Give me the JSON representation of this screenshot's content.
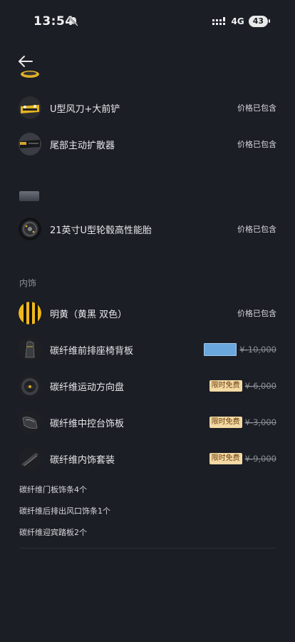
{
  "status_bar": {
    "time": "13:54",
    "network": "4G",
    "battery": "43"
  },
  "header": {
    "back_icon": "arrow-left-icon"
  },
  "exterior_items": [
    {
      "name": "U型风刀+大前铲",
      "price_text": "价格已包含"
    },
    {
      "name": "尾部主动扩散器",
      "price_text": "价格已包含"
    },
    {
      "name": "21英寸U型轮毂高性能胎",
      "price_text": "价格已包含"
    }
  ],
  "interior": {
    "section_title": "内饰",
    "items": [
      {
        "name": "明黄（黄黑 双色）",
        "price_text": "价格已包含"
      },
      {
        "name": "碳纤维前排座椅背板",
        "price": "¥-10,000"
      },
      {
        "name": "碳纤维运动方向盘",
        "badge": "限时免费",
        "price": "¥-6,000"
      },
      {
        "name": "碳纤维中控台饰板",
        "badge": "限时免费",
        "price": "¥-3,000"
      },
      {
        "name": "碳纤维内饰套装",
        "badge": "限时免费",
        "price": "¥-9,000"
      }
    ],
    "sub_items": [
      "碳纤维门板饰条4个",
      "碳纤维后排出风口饰条1个",
      "碳纤维迎宾踏板2个"
    ]
  },
  "colors": {
    "background": "#1b1e25",
    "badge_bg": "#f3d9a4",
    "badge_text": "#6a3d0c",
    "accent_yellow": "#f0b81c"
  }
}
